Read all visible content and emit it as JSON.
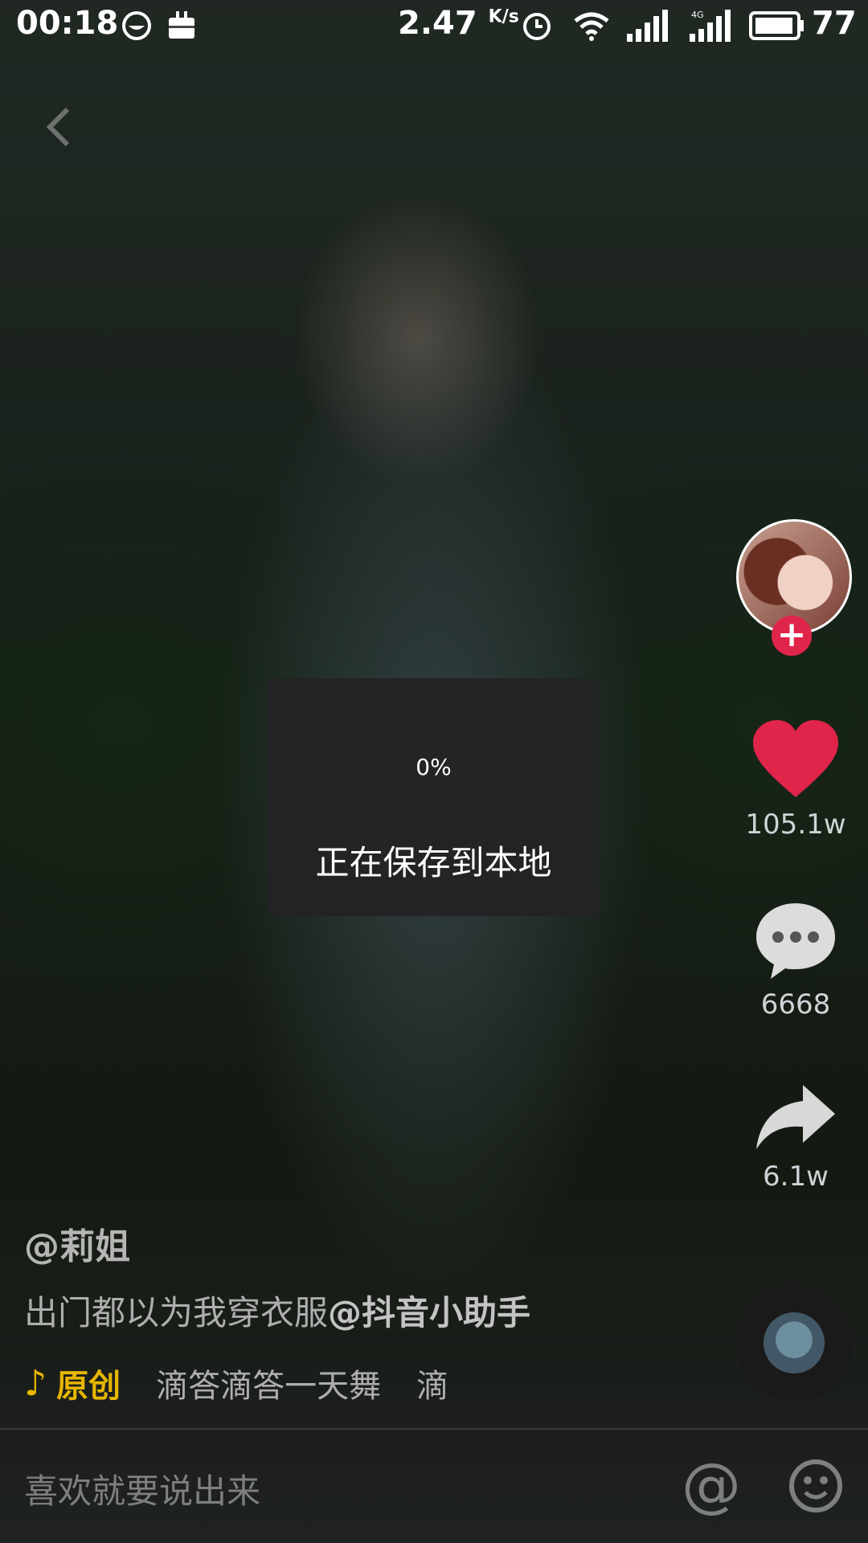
{
  "status_bar": {
    "time": "00:18",
    "net_speed": "2.47",
    "net_speed_unit": "K/s",
    "battery": "77",
    "network_type": "4G",
    "icons": [
      "chat-bubble-icon",
      "briefcase-icon",
      "alarm-icon",
      "wifi-icon",
      "signal-icon",
      "signal-4g-icon",
      "battery-icon"
    ]
  },
  "toast": {
    "percent": "0%",
    "message": "正在保存到本地"
  },
  "right_rail": {
    "likes": "105.1w",
    "comments": "6668",
    "shares": "6.1w",
    "like_color": "#e0244a"
  },
  "video_info": {
    "author": "@莉姐",
    "description_text": "出门都以为我穿衣服",
    "description_mention": "@抖音小助手",
    "music_tag": "原创",
    "music_title": "滴答滴答一天舞",
    "music_title_next": "滴"
  },
  "comment_bar": {
    "placeholder": "喜欢就要说出来",
    "at_symbol": "@"
  },
  "colors": {
    "accent_gold": "#e6b600",
    "follow_red": "#e0244a"
  }
}
